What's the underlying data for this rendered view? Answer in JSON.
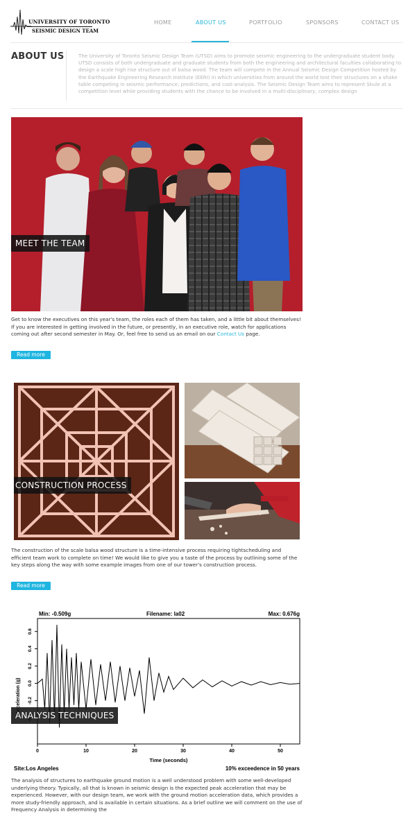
{
  "header": {
    "logo_title": "UNIVERSITY OF TORONTO",
    "logo_subtitle": "SEISMIC DESIGN TEAM",
    "nav": [
      {
        "label": "HOME",
        "active": false
      },
      {
        "label": "ABOUT US",
        "active": true
      },
      {
        "label": "PORTFOLIO",
        "active": false
      },
      {
        "label": "SPONSORS",
        "active": false
      },
      {
        "label": "CONTACT US",
        "active": false
      }
    ],
    "accent_color": "#29b6d8"
  },
  "about": {
    "title": "ABOUT US",
    "text": "The University of Toronto Seismic Design Team (UTSD) aims to promote seismic engineering to the undergraduate student body. UTSD consists of both undergraduate and graduate students from both the engineering and architectural faculties collaborating to design a scale high rise structure out of balsa wood. The team will compete in the Annual Seismic Design Competition hosted by the Earthquake Engineering Research Institute (EERI) in which universities from around the world test their structures on a shake table competing in seismic performance, predictions, and cost-analysis. The Seismic Design Team aims to represent Skule at a competition level while providing students with the chance to be involved in a multi-disciplinary, complex design"
  },
  "sections": {
    "team": {
      "caption": "MEET THE TEAM",
      "text_before_link": "Get to know the executives on this year's team, the roles each of them has taken, and a little bit about themselves! If you are interested in getting involved in the future, or presently, in an executive role, watch for applications coming out after second semester in May. Or, feel free to send us an email on our ",
      "link": "Contact Us",
      "text_after_link": " page.",
      "button": "Read more"
    },
    "construction": {
      "caption": "CONSTRUCTION PROCESS",
      "text": "The construction of the scale balsa wood structure is a time-intensive process requiring tightscheduling and efficient team work to complete on time! We would like to give you a taste of the process by outlining some of the key steps along the way with some example images from one of our tower's construction process.",
      "button": "Read more"
    },
    "analysis": {
      "caption": "ANALYSIS TECHNIQUES",
      "text": "The analysis of structures to earthquake ground motion is a well understood problem with some well-developed underlying theory. Typically, all that is known in seismic design is the expected peak acceleration that may be experienced. However, with our design team, we work with the ground motion acceleration data, which provides a more study-friendly approach, and is available in certain situations. As a brief outline we will comment on the use of Frequency Analysis in determining the"
    }
  },
  "chart_data": {
    "type": "line",
    "header_left": "Min: -0.509g",
    "header_center": "Filename: la02",
    "header_right": "Max: 0.676g",
    "xlabel": "Time (seconds)",
    "ylabel": "Acceleration (g)",
    "xlim": [
      0,
      54
    ],
    "ylim": [
      -0.7,
      0.75
    ],
    "xticks": [
      0,
      10,
      20,
      30,
      40,
      50
    ],
    "yticks": [
      -0.4,
      -0.2,
      0.0,
      0.2,
      0.4,
      0.6
    ],
    "footer_left": "Site:Los Angeles",
    "footer_right": "10% exceedence in 50 years",
    "min": -0.509,
    "max": 0.676,
    "series": [
      {
        "x": [
          0,
          1,
          1.5,
          2,
          2.5,
          3,
          3.5,
          4,
          4.5,
          5,
          5.5,
          6,
          6.5,
          7,
          7.5,
          8,
          8.5,
          9,
          10,
          11,
          12,
          13,
          14,
          15,
          16,
          17,
          18,
          19,
          20,
          21,
          22,
          23,
          24,
          25,
          26,
          27,
          28,
          30,
          32,
          34,
          36,
          38,
          40,
          42,
          44,
          46,
          48,
          50,
          52,
          54
        ],
        "y": [
          0.0,
          0.05,
          -0.3,
          0.35,
          -0.45,
          0.5,
          -0.4,
          0.676,
          -0.509,
          0.45,
          -0.35,
          0.4,
          -0.3,
          0.3,
          -0.25,
          0.35,
          -0.3,
          0.25,
          -0.3,
          0.28,
          -0.25,
          0.22,
          -0.2,
          0.25,
          -0.22,
          0.2,
          -0.2,
          0.18,
          -0.15,
          0.15,
          -0.35,
          0.3,
          -0.2,
          0.12,
          -0.1,
          0.08,
          -0.07,
          0.06,
          -0.05,
          0.04,
          -0.04,
          0.03,
          -0.03,
          0.02,
          -0.02,
          0.02,
          -0.015,
          0.01,
          -0.01,
          0.0
        ]
      }
    ]
  }
}
